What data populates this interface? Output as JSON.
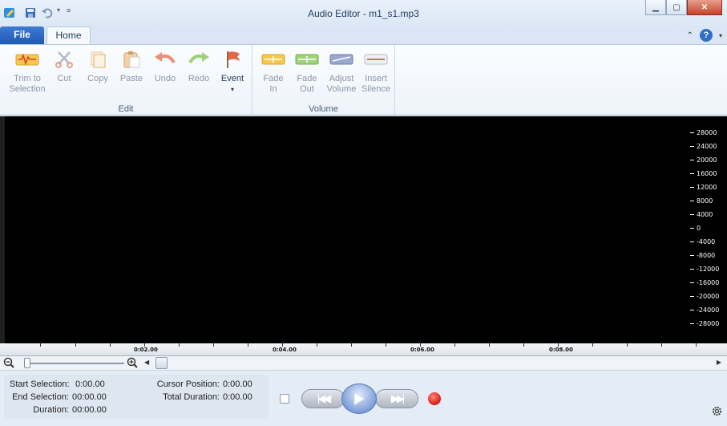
{
  "window": {
    "title": "Audio Editor - m1_s1.mp3"
  },
  "tabs": {
    "file": "File",
    "home": "Home"
  },
  "ribbon": {
    "edit_group": {
      "label": "Edit",
      "buttons": [
        {
          "line1": "Trim to",
          "line2": "Selection",
          "icon": "trim-icon",
          "enabled": false
        },
        {
          "line1": "Cut",
          "line2": "",
          "icon": "scissors-icon",
          "enabled": false
        },
        {
          "line1": "Copy",
          "line2": "",
          "icon": "copy-icon",
          "enabled": false
        },
        {
          "line1": "Paste",
          "line2": "",
          "icon": "paste-icon",
          "enabled": false
        },
        {
          "line1": "Undo",
          "line2": "",
          "icon": "undo-icon",
          "enabled": false
        },
        {
          "line1": "Redo",
          "line2": "",
          "icon": "redo-icon",
          "enabled": false
        },
        {
          "line1": "Event",
          "line2": "▾",
          "icon": "flag-icon",
          "enabled": true
        }
      ]
    },
    "volume_group": {
      "label": "Volume",
      "buttons": [
        {
          "line1": "Fade",
          "line2": "In",
          "icon": "fade-in-icon",
          "enabled": false
        },
        {
          "line1": "Fade",
          "line2": "Out",
          "icon": "fade-out-icon",
          "enabled": false
        },
        {
          "line1": "Adjust",
          "line2": "Volume",
          "icon": "adjust-volume-icon",
          "enabled": false
        },
        {
          "line1": "Insert",
          "line2": "Silence",
          "icon": "insert-silence-icon",
          "enabled": false
        }
      ]
    }
  },
  "waveform": {
    "amplitude_labels": [
      "28000",
      "24000",
      "20000",
      "16000",
      "12000",
      "8000",
      "4000",
      "0",
      "-4000",
      "-8000",
      "-12000",
      "-16000",
      "-20000",
      "-24000",
      "-28000"
    ]
  },
  "timeline": {
    "labels": [
      "0:02.00",
      "0:04.00",
      "0:06.00",
      "0:08.00"
    ]
  },
  "status": {
    "start_selection_label": "Start Selection:",
    "start_selection_value": "0:00.00",
    "end_selection_label": "End Selection:",
    "end_selection_value": "00:00.00",
    "duration_label": "Duration:",
    "duration_value": "00:00.00",
    "cursor_position_label": "Cursor Position:",
    "cursor_position_value": "0:00.00",
    "total_duration_label": "Total Duration:",
    "total_duration_value": "0:00.00"
  },
  "colors": {
    "file_tab": "#2a65c0",
    "waveform_bg": "#000000",
    "record": "#e0201b"
  }
}
